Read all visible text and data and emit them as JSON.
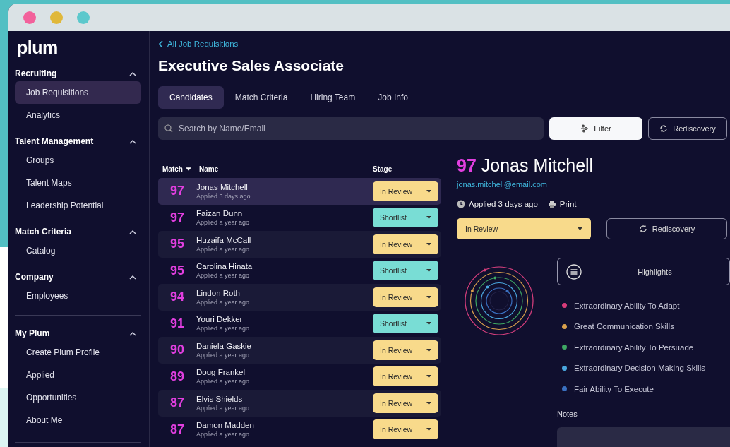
{
  "window": {
    "controls": [
      {
        "color": "#f2619b"
      },
      {
        "color": "#e0b83a"
      },
      {
        "color": "#5cc8cc"
      }
    ]
  },
  "sidebar": {
    "logo": "plum",
    "sections": [
      {
        "title": "Recruiting",
        "expanded": true,
        "separated": false,
        "items": [
          {
            "label": "Job Requisitions",
            "selected": true
          },
          {
            "label": "Analytics",
            "selected": false
          }
        ]
      },
      {
        "title": "Talent Management",
        "expanded": true,
        "separated": false,
        "items": [
          {
            "label": "Groups",
            "selected": false
          },
          {
            "label": "Talent Maps",
            "selected": false
          },
          {
            "label": "Leadership Potential",
            "selected": false
          }
        ]
      },
      {
        "title": "Match Criteria",
        "expanded": true,
        "separated": false,
        "items": [
          {
            "label": "Catalog",
            "selected": false
          }
        ]
      },
      {
        "title": "Company",
        "expanded": true,
        "separated": false,
        "items": [
          {
            "label": "Employees",
            "selected": false
          }
        ]
      },
      {
        "title": "My Plum",
        "expanded": true,
        "separated": true,
        "items": [
          {
            "label": "Create Plum Profile",
            "selected": false
          },
          {
            "label": "Applied",
            "selected": false
          },
          {
            "label": "Opportunities",
            "selected": false
          },
          {
            "label": "About Me",
            "selected": false
          }
        ]
      }
    ]
  },
  "page": {
    "back_link": "All Job Requisitions",
    "title": "Executive Sales Associate",
    "tabs": [
      {
        "label": "Candidates",
        "selected": true
      },
      {
        "label": "Match Criteria",
        "selected": false
      },
      {
        "label": "Hiring Team",
        "selected": false
      },
      {
        "label": "Job Info",
        "selected": false
      }
    ],
    "search": {
      "placeholder": "Search by Name/Email"
    },
    "actions": [
      {
        "kind": "filter",
        "label": "Filter"
      },
      {
        "kind": "rediscovery",
        "label": "Rediscovery"
      }
    ]
  },
  "table": {
    "columns": [
      {
        "label": "Match",
        "sorted": true
      },
      {
        "label": "Name",
        "sorted": false
      },
      {
        "label": "Stage",
        "sorted": false
      }
    ],
    "rows": [
      {
        "match": "97",
        "name": "Jonas Mitchell",
        "applied": "Applied 3 days ago",
        "stage": {
          "label": "In Review",
          "color": "#f8da8b"
        },
        "selected": true
      },
      {
        "match": "97",
        "name": "Faizan Dunn",
        "applied": "Applied a year ago",
        "stage": {
          "label": "Shortlist",
          "color": "#79ddd5"
        },
        "selected": false
      },
      {
        "match": "95",
        "name": "Huzaifa McCall",
        "applied": "Applied a year ago",
        "stage": {
          "label": "In Review",
          "color": "#f8da8b"
        },
        "selected": false
      },
      {
        "match": "95",
        "name": "Carolina Hinata",
        "applied": "Applied a year ago",
        "stage": {
          "label": "Shortlist",
          "color": "#79ddd5"
        },
        "selected": false
      },
      {
        "match": "94",
        "name": "Lindon Roth",
        "applied": "Applied a year ago",
        "stage": {
          "label": "In Review",
          "color": "#f8da8b"
        },
        "selected": false
      },
      {
        "match": "91",
        "name": "Youri Dekker",
        "applied": "Applied a year ago",
        "stage": {
          "label": "Shortlist",
          "color": "#79ddd5"
        },
        "selected": false
      },
      {
        "match": "90",
        "name": "Daniela Gaskie",
        "applied": "Applied a year ago",
        "stage": {
          "label": "In Review",
          "color": "#f8da8b"
        },
        "selected": false
      },
      {
        "match": "89",
        "name": "Doug Frankel",
        "applied": "Applied a year ago",
        "stage": {
          "label": "In Review",
          "color": "#f8da8b"
        },
        "selected": false
      },
      {
        "match": "87",
        "name": "Elvis Shields",
        "applied": "Applied a year ago",
        "stage": {
          "label": "In Review",
          "color": "#f8da8b"
        },
        "selected": false
      },
      {
        "match": "87",
        "name": "Damon Madden",
        "applied": "Applied a year ago",
        "stage": {
          "label": "In Review",
          "color": "#f8da8b"
        },
        "selected": false
      }
    ]
  },
  "detail": {
    "score": "97",
    "name": "Jonas Mitchell",
    "email": "jonas.mitchell@email.com",
    "applied": "Applied 3 days ago",
    "print": "Print",
    "stage": {
      "label": "In Review",
      "color": "#f8da8b"
    },
    "rediscovery": "Rediscovery",
    "highlights": {
      "label": "Highlights",
      "items": [
        {
          "label": "Extraordinary Ability To Adapt",
          "color": "#d83c7a"
        },
        {
          "label": "Great Communication Skills",
          "color": "#d9a04c"
        },
        {
          "label": "Extraordinary Ability To Persuade",
          "color": "#3ea864"
        },
        {
          "label": "Extraordinary Decision Making Skills",
          "color": "#4aa6de"
        },
        {
          "label": "Fair Ability To Execute",
          "color": "#3a70c0"
        }
      ]
    },
    "notes_label": "Notes"
  }
}
